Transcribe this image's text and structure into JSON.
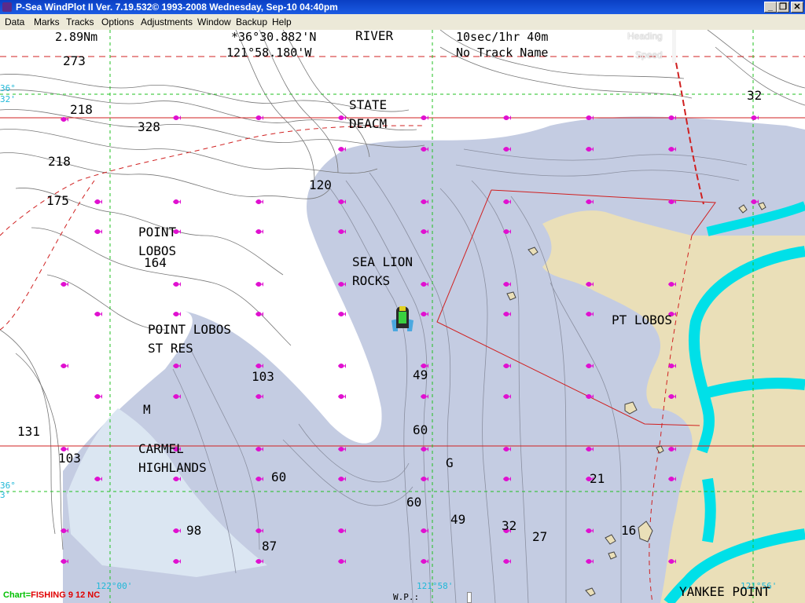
{
  "window": {
    "title": "P-Sea WindPlot II Ver. 7.19.532© 1993-2008  Wednesday, Sep-10  04:40pm",
    "minimize": "_",
    "restore": "❐",
    "close": "✕"
  },
  "menu": [
    "Data",
    "Marks",
    "Tracks",
    "Options",
    "Adjustments",
    "Window",
    "Backup",
    "Help"
  ],
  "overlay": {
    "range": "2.89Nm",
    "lat": "*36°30.882'N",
    "lon": "121°58.180'W",
    "track_interval": "10sec/1hr 40m",
    "track_name": "No Track Name",
    "heading_label": "Heading",
    "speed_label": "Speed",
    "chart_prefix": "Chart=",
    "chart_name": "FISHING 9 12 NC",
    "waypoint_label": "W.P.:"
  },
  "grid_labels": {
    "lat_top_1": "36°",
    "lat_top_2": "32'",
    "lat_bot_1": "36°",
    "lat_bot_2": "3'",
    "lon_left": "122°00'",
    "lon_mid": "121°58'",
    "lon_right": "121°56'"
  },
  "places": {
    "river": "RIVER",
    "state_beach_1": "STATE",
    "state_beach_2": "DEACM",
    "point_lobos_1": "POINT",
    "point_lobos_2": "LOBOS",
    "sea_lion_1": "SEA LION",
    "sea_lion_2": "ROCKS",
    "pl_res_1": "POINT LOBOS",
    "pl_res_2": "ST RES",
    "carmel_1": "CARMEL",
    "carmel_2": "HIGHLANDS",
    "pt_lobos": "PT LOBOS",
    "yankee": "YANKEE POINT",
    "m_mark": "M",
    "g_mark": "G"
  },
  "depths": [
    "273",
    "218",
    "328",
    "218",
    "175",
    "164",
    "120",
    "32",
    "103",
    "49",
    "60",
    "131",
    "103",
    "60",
    "60",
    "49",
    "32",
    "27",
    "21",
    "16",
    "98",
    "87"
  ],
  "colors": {
    "land": "#eadfb8",
    "deep_water": "#c4cce2",
    "shallow_water": "#dbe6f2",
    "river": "#00e0e8",
    "marker": "#e010d0",
    "grid_green": "#20c020",
    "grid_red": "#d02020",
    "contour": "#777777"
  },
  "icons": {
    "vessel": "boat-icon",
    "marker": "fish-marker-icon"
  }
}
